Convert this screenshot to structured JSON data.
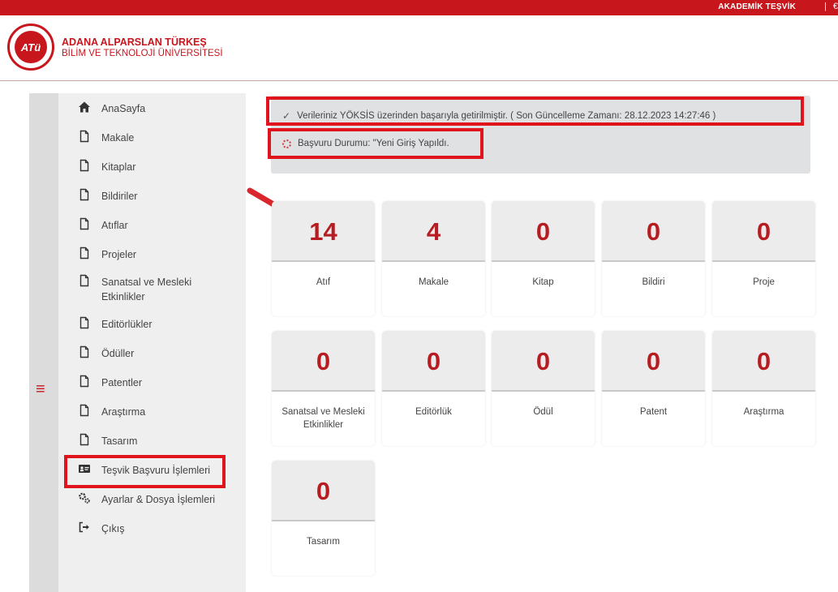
{
  "topbar": {
    "link": "AKADEMİK TEŞVİK",
    "separator": "|",
    "extra": "€"
  },
  "header": {
    "logo_text": "ATü",
    "uni_line1": "ADANA ALPARSLAN TÜRKEŞ",
    "uni_line2": "BİLİM VE TEKNOLOJİ ÜNİVERSİTESİ"
  },
  "rail": {
    "menu_glyph": "≡"
  },
  "sidebar": {
    "items": [
      {
        "label": "AnaSayfa",
        "icon": "home-icon"
      },
      {
        "label": "Makale",
        "icon": "document-icon"
      },
      {
        "label": "Kitaplar",
        "icon": "document-icon"
      },
      {
        "label": "Bildiriler",
        "icon": "document-icon"
      },
      {
        "label": "Atıflar",
        "icon": "document-icon"
      },
      {
        "label": "Projeler",
        "icon": "document-icon"
      },
      {
        "label": "Sanatsal ve Mesleki",
        "label2": "Etkinlikler",
        "icon": "document-icon"
      },
      {
        "label": "Editörlükler",
        "icon": "document-icon"
      },
      {
        "label": "Ödüller",
        "icon": "document-icon"
      },
      {
        "label": "Patentler",
        "icon": "document-icon"
      },
      {
        "label": "Araştırma",
        "icon": "document-icon"
      },
      {
        "label": "Tasarım",
        "icon": "document-icon"
      },
      {
        "label": "Teşvik Başvuru İşlemleri",
        "icon": "id-card-icon"
      },
      {
        "label": "Ayarlar & Dosya İşlemleri",
        "icon": "gears-icon"
      },
      {
        "label": "Çıkış",
        "icon": "sign-out-icon"
      }
    ]
  },
  "status": {
    "check_glyph": "✓",
    "sync_message": "Verileriniz YÖKSİS üzerinden başarıyla getirilmiştir. ( Son Güncelleme Zamanı: 28.12.2023 14:27:46 )",
    "application_status": "Başvuru Durumu: \"Yeni Giriş Yapıldı."
  },
  "cards": [
    {
      "value": "14",
      "label": "Atıf"
    },
    {
      "value": "4",
      "label": "Makale"
    },
    {
      "value": "0",
      "label": "Kitap"
    },
    {
      "value": "0",
      "label": "Bildiri"
    },
    {
      "value": "0",
      "label": "Proje"
    },
    {
      "value": "0",
      "label": "Sanatsal ve Mesleki",
      "label2": "Etkinlikler"
    },
    {
      "value": "0",
      "label": "Editörlük"
    },
    {
      "value": "0",
      "label": "Ödül"
    },
    {
      "value": "0",
      "label": "Patent"
    },
    {
      "value": "0",
      "label": "Araştırma"
    },
    {
      "value": "0",
      "label": "Tasarım"
    }
  ],
  "colors": {
    "brand_red": "#c8161d",
    "number_red": "#b71c22",
    "highlight_red": "#e0141d"
  }
}
